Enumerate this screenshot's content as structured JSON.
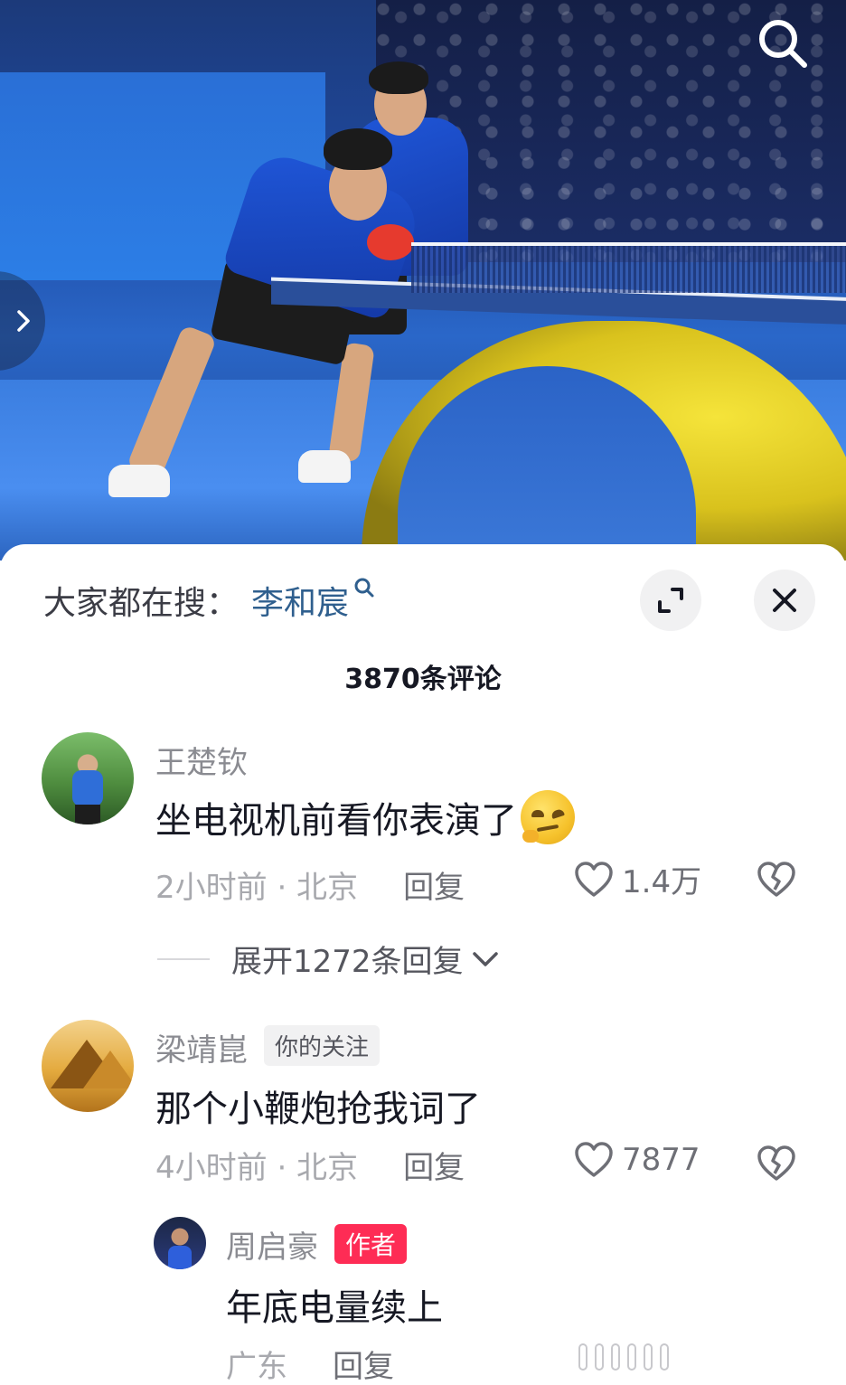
{
  "hot_search": {
    "prefix": "大家都在搜：",
    "keyword": "李和宸"
  },
  "comments_header": {
    "count_label": "3870条评论"
  },
  "comments": [
    {
      "user": "王楚钦",
      "text": "坐电视机前看你表演了",
      "emoji": "smirk-emoji",
      "time_location": "2小时前 · 北京",
      "reply_label": "回复",
      "likes": "1.4万",
      "expand_label": "展开1272条回复"
    },
    {
      "user": "梁靖崑",
      "tag": "你的关注",
      "text": "那个小鞭炮抢我词了",
      "time_location": "4小时前 · 北京",
      "reply_label": "回复",
      "likes": "7877",
      "replies": [
        {
          "user": "周启豪",
          "tag": "作者",
          "text": "年底电量续上",
          "location": "广东",
          "reply_label": "回复"
        }
      ]
    }
  ],
  "colors": {
    "keyword": "#2f5f8e",
    "author_tag": "#fe2c55",
    "muted_text": "#a8a9ae"
  },
  "icons": [
    "search-icon",
    "chevron-right-icon",
    "search-small-icon",
    "expand-icon",
    "close-icon",
    "heart-icon",
    "broken-heart-icon",
    "chevron-down-icon"
  ]
}
